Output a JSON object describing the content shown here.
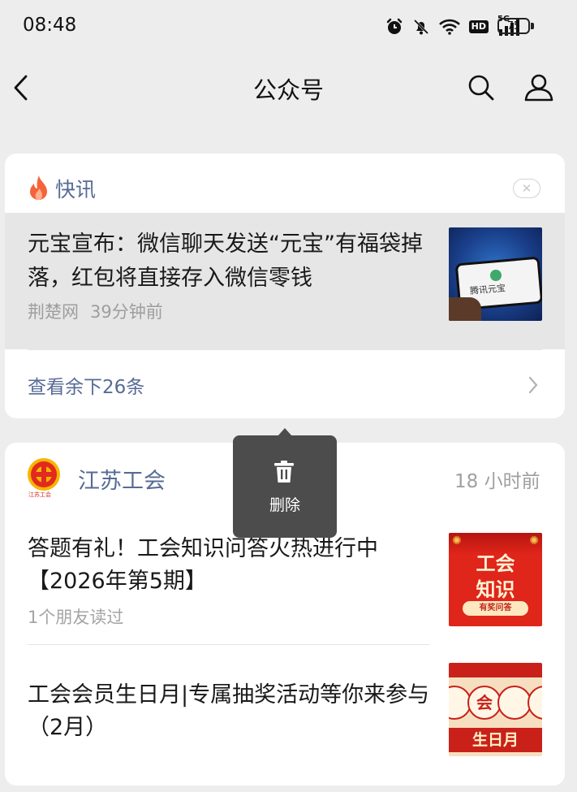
{
  "status_bar": {
    "time": "08:48",
    "network": "5G",
    "hd": "HD",
    "battery": "75",
    "icons": [
      "alarm-icon",
      "mute-icon",
      "wifi-icon",
      "hd-icon",
      "signal-icon",
      "battery-icon"
    ]
  },
  "header": {
    "back_icon": "back-arrow-icon",
    "title": "公众号",
    "search_icon": "search-icon",
    "profile_icon": "person-icon"
  },
  "news_card": {
    "heading": "快讯",
    "heading_icon": "flame-icon",
    "close_label": "✕",
    "item": {
      "title": "元宝宣布：微信聊天发送“元宝”有福袋掉落，红包将直接存入微信零钱",
      "source": "荆楚网",
      "time": "39分钟前",
      "thumb_caption": "腾讯元宝"
    },
    "more_label": "查看余下26条"
  },
  "account_card": {
    "name": "江苏工会",
    "logo_caption": "江苏工会",
    "time": "18 小时前",
    "articles": [
      {
        "title": "答题有礼！工会知识问答火热进行中【2026年第5期】",
        "meta": "1个朋友读过",
        "thumb_line1": "工会",
        "thumb_line2": "知识",
        "thumb_tag": "有奖问答"
      },
      {
        "title": "工会会员生日月|专属抽奖活动等你来参与（2月）",
        "thumb_bubble": "会",
        "thumb_line": "生日月"
      }
    ]
  },
  "context_menu": {
    "delete_label": "删除",
    "delete_icon": "trash-icon"
  },
  "colors": {
    "background": "#ededed",
    "link": "#576b95",
    "flame": "#f5633a",
    "popup": "#4c4c4c"
  }
}
